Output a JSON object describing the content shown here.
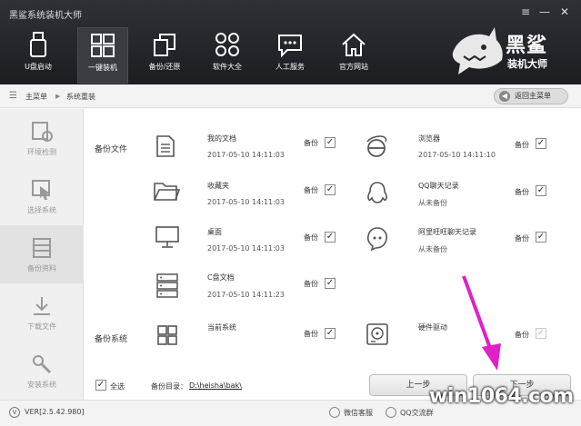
{
  "app": {
    "title": "黑鲨系统装机大师",
    "version": "VER[2.5.42.980]"
  },
  "window_controls": {
    "menu": "≡",
    "minimize": "—",
    "close": "✕"
  },
  "nav": [
    {
      "label": "U盘启动",
      "icon": "usb-icon"
    },
    {
      "label": "一键装机",
      "icon": "windows-icon",
      "active": true
    },
    {
      "label": "备份/还原",
      "icon": "backup-restore-icon"
    },
    {
      "label": "软件大全",
      "icon": "apps-grid-icon"
    },
    {
      "label": "人工服务",
      "icon": "chat-icon"
    },
    {
      "label": "官方网站",
      "icon": "home-icon"
    }
  ],
  "logo": {
    "text_line1": "黑鲨",
    "text_line2": "装机大师"
  },
  "breadcrumb": {
    "root": "主菜单",
    "separator": "▶",
    "current": "系统重装"
  },
  "back_button": "返回主菜单",
  "sidebar": [
    {
      "label": "环境检测",
      "icon": "env-check-icon"
    },
    {
      "label": "选择系统",
      "icon": "select-system-icon"
    },
    {
      "label": "备份资料",
      "icon": "backup-data-icon",
      "active": true
    },
    {
      "label": "下载文件",
      "icon": "download-icon"
    },
    {
      "label": "安装系统",
      "icon": "install-icon"
    }
  ],
  "sections": {
    "files": "备份文件",
    "system": "备份系统"
  },
  "backup_word": "备份",
  "check_mark": "✓",
  "left_items": [
    {
      "name": "我的文档",
      "date": "2017-05-10 14:11:03",
      "icon": "document-icon",
      "checked": true
    },
    {
      "name": "收藏夹",
      "date": "2017-05-10 14:11:03",
      "icon": "folder-icon",
      "checked": true
    },
    {
      "name": "桌面",
      "date": "2017-05-10 14:11:03",
      "icon": "monitor-icon",
      "checked": true
    },
    {
      "name": "C盘文档",
      "date": "2017-05-10 14:11:23",
      "icon": "server-icon",
      "checked": true
    },
    {
      "name": "当前系统",
      "date": "",
      "icon": "windows-small-icon",
      "checked": true
    }
  ],
  "right_items": [
    {
      "name": "浏览器",
      "date": "2017-05-10 14:11:10",
      "icon": "ie-icon",
      "checked": true
    },
    {
      "name": "QQ聊天记录",
      "date": "从未备份",
      "icon": "qq-icon",
      "checked": true
    },
    {
      "name": "阿里旺旺聊天记录",
      "date": "从未备份",
      "icon": "aliwangwang-icon",
      "checked": true
    },
    {
      "name": "硬件驱动",
      "date": "",
      "icon": "hdd-icon",
      "checked": true,
      "disabled": true
    }
  ],
  "select_all": "全选",
  "backup_dir": {
    "label": "备份目录：",
    "path": "D:\\heisha\\bak\\"
  },
  "prev_button": "上一步",
  "next_button": "下一步",
  "footer": {
    "wechat": "微信客服",
    "qq": "QQ交流群"
  },
  "watermark": "win1064.com",
  "colors": {
    "topbar": "#25272b",
    "arrow": "#e020c8"
  }
}
